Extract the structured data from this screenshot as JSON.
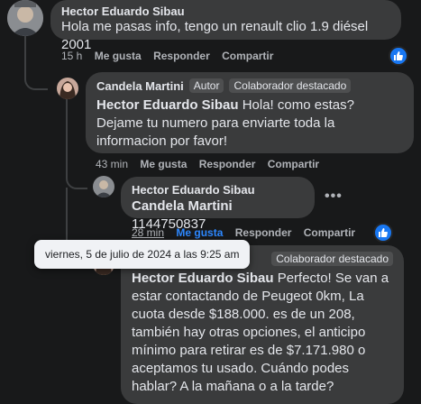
{
  "comments": [
    {
      "author": "Hector Eduardo Sibau",
      "text": "Hola me pasas info, tengo un renault clio 1.9 diésel 2001",
      "time": "15 h",
      "like": "Me gusta",
      "reply": "Responder",
      "share": "Compartir"
    },
    {
      "author": "Candela Martini",
      "badge_author": "Autor",
      "badge_featured": "Colaborador destacado",
      "mention": "Hector Eduardo Sibau",
      "text": " Hola! como estas? Dejame tu numero para enviarte toda la informacion por favor!",
      "time": "43 min",
      "like": "Me gusta",
      "reply": "Responder",
      "share": "Compartir"
    },
    {
      "author": "Hector Eduardo Sibau",
      "mention": "Candela Martini",
      "text": " 1144750837",
      "time": "28 min",
      "like": "Me gusta",
      "reply": "Responder",
      "share": "Compartir"
    },
    {
      "badge_featured": "Colaborador destacado",
      "mention": "Hector Eduardo Sibau",
      "text": " Perfecto! Se van a estar contactando de Peugeot 0km, La cuota desde $188.000. es de un 208, también hay otras opciones, el anticipo mínimo para retirar es de $7.171.980 o aceptamos tu usado. Cuándo podes hablar? A la mañana o a la tarde?"
    }
  ],
  "tooltip": "viernes, 5 de julio de 2024 a las 9:25 am",
  "more_options": "•••",
  "colors": {
    "accent": "#2d88ff",
    "like_blue": "#1877f2",
    "bubble": "#3a3b3c"
  }
}
